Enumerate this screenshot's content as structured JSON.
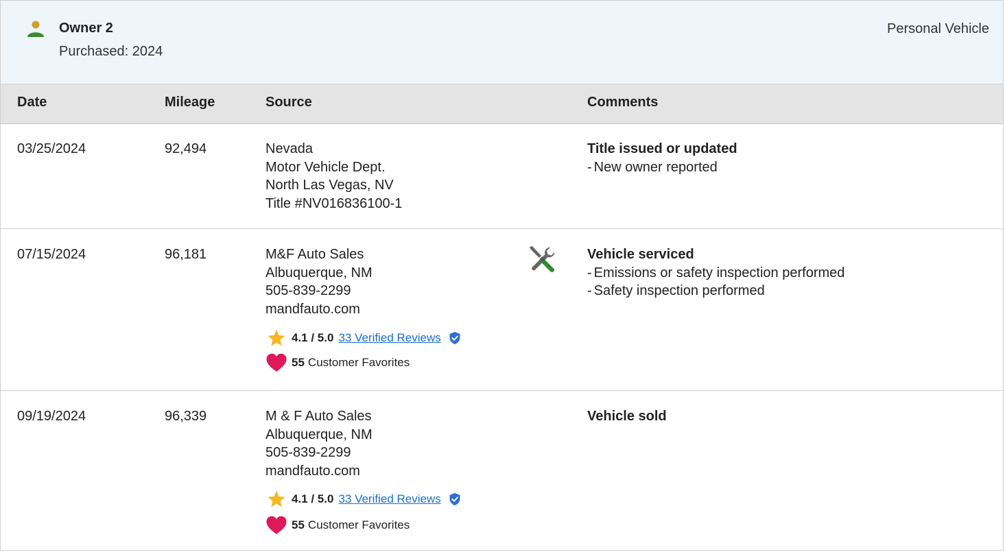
{
  "owner": {
    "name": "Owner 2",
    "purchased": "Purchased: 2024",
    "type": "Personal Vehicle",
    "icon": "person-icon",
    "icon_color": "#3a8a2e"
  },
  "table": {
    "headers": {
      "date": "Date",
      "mileage": "Mileage",
      "source": "Source",
      "comments": "Comments"
    },
    "rows": [
      {
        "date": "03/25/2024",
        "mileage": "92,494",
        "source": [
          "Nevada",
          "Motor Vehicle Dept.",
          "North Las Vegas, NV",
          "Title #NV016836100-1"
        ],
        "comment_title": "Title issued or updated",
        "comment_items": [
          "New owner reported"
        ]
      },
      {
        "date": "07/15/2024",
        "mileage": "96,181",
        "source": [
          "M&F Auto Sales",
          "Albuquerque, NM",
          "505-839-2299",
          "mandfauto.com"
        ],
        "rating": "4.1 / 5.0",
        "reviews_link": "33 Verified Reviews",
        "favorites_count": "55",
        "favorites_label": "Customer Favorites",
        "icon": "wrench-screwdriver-icon",
        "comment_title": "Vehicle serviced",
        "comment_items": [
          "Emissions or safety inspection performed",
          "Safety inspection performed"
        ]
      },
      {
        "date": "09/19/2024",
        "mileage": "96,339",
        "source": [
          "M & F Auto Sales",
          "Albuquerque, NM",
          "505-839-2299",
          "mandfauto.com"
        ],
        "rating": "4.1 / 5.0",
        "reviews_link": "33 Verified Reviews",
        "favorites_count": "55",
        "favorites_label": "Customer Favorites",
        "comment_title": "Vehicle sold",
        "comment_items": []
      }
    ]
  },
  "colors": {
    "header_bg": "#eef5fb",
    "table_header_bg": "#e4e4e4",
    "link": "#1a6fc9",
    "star": "#f6b820",
    "heart": "#e0195b",
    "verified": "#2f6fcf",
    "service_green": "#2e8b2e"
  },
  "icons": {
    "rating": "star-icon",
    "verified": "verified-shield-icon",
    "favorites": "heart-icon"
  }
}
